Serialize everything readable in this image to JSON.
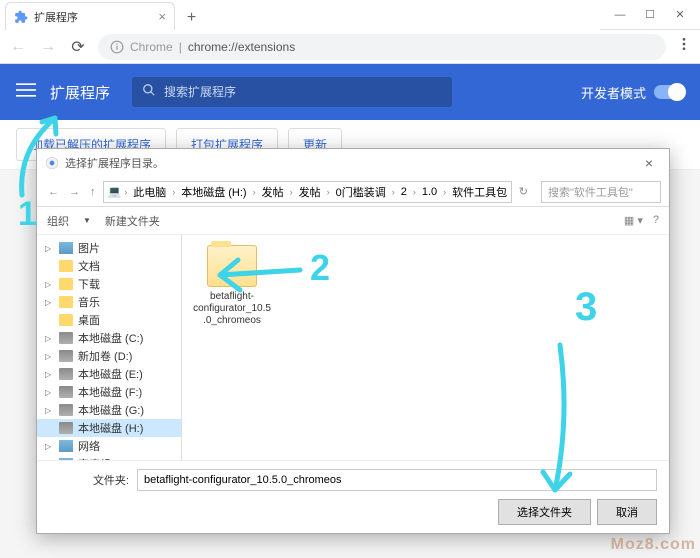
{
  "tab": {
    "title": "扩展程序"
  },
  "window_controls": {
    "min": "—",
    "max": "☐",
    "close": "✕"
  },
  "omnibox": {
    "scheme_label": "Chrome",
    "url": "chrome://extensions"
  },
  "ext_header": {
    "title": "扩展程序",
    "search_placeholder": "搜索扩展程序",
    "dev_mode_label": "开发者模式"
  },
  "actions": {
    "load_unpacked": "加载已解压的扩展程序",
    "pack": "打包扩展程序",
    "update": "更新"
  },
  "dialog": {
    "title": "选择扩展程序目录。",
    "breadcrumbs": [
      "此电脑",
      "本地磁盘 (H:)",
      "发帖",
      "发帖",
      "0门槛装调",
      "2",
      "1.0",
      "软件工具包"
    ],
    "search_placeholder": "搜索\"软件工具包\"",
    "toolbar": {
      "organize": "组织",
      "new_folder": "新建文件夹"
    },
    "tree": [
      {
        "label": "图片",
        "icon": "img-ico",
        "caret": "▷"
      },
      {
        "label": "文档",
        "icon": "folder-ico",
        "caret": ""
      },
      {
        "label": "下载",
        "icon": "folder-ico",
        "caret": "▷"
      },
      {
        "label": "音乐",
        "icon": "folder-ico",
        "caret": "▷"
      },
      {
        "label": "桌面",
        "icon": "folder-ico",
        "caret": ""
      },
      {
        "label": "本地磁盘 (C:)",
        "icon": "drive-icon",
        "caret": "▷"
      },
      {
        "label": "新加卷 (D:)",
        "icon": "drive-icon",
        "caret": "▷"
      },
      {
        "label": "本地磁盘 (E:)",
        "icon": "drive-icon",
        "caret": "▷"
      },
      {
        "label": "本地磁盘 (F:)",
        "icon": "drive-icon",
        "caret": "▷"
      },
      {
        "label": "本地磁盘 (G:)",
        "icon": "drive-icon",
        "caret": "▷"
      },
      {
        "label": "本地磁盘 (H:)",
        "icon": "drive-icon",
        "caret": "",
        "selected": true
      },
      {
        "label": "网络",
        "icon": "img-ico",
        "caret": "▷"
      },
      {
        "label": "家庭组",
        "icon": "img-ico",
        "caret": ""
      }
    ],
    "folder_item": "betaflight-configurator_10.5.0_chromeos",
    "footer": {
      "label": "文件夹:",
      "value": "betaflight-configurator_10.5.0_chromeos",
      "select_btn": "选择文件夹",
      "cancel_btn": "取消"
    }
  },
  "annotations": {
    "n1": "1",
    "n2": "2",
    "n3": "3"
  },
  "watermark": "Moz8.com"
}
